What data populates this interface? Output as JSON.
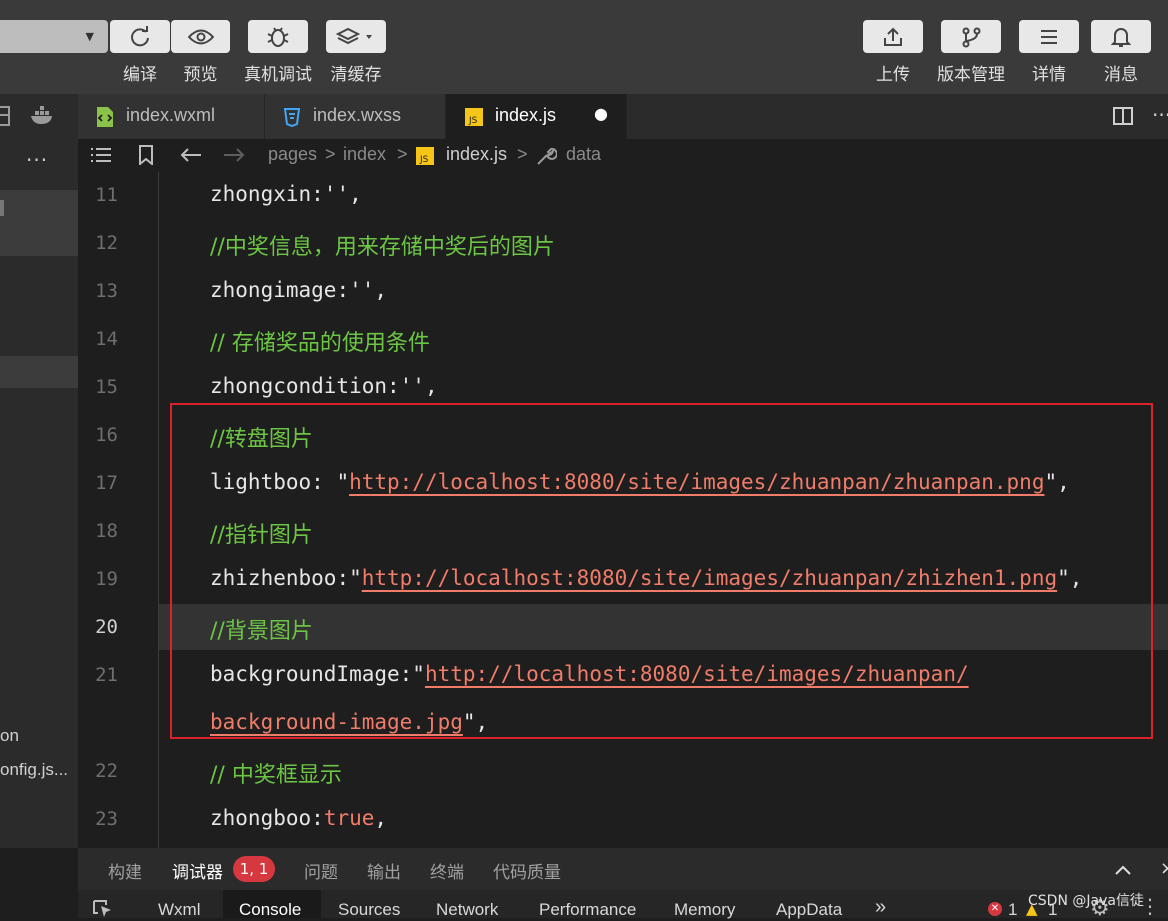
{
  "toolbar": {
    "left_buttons": [
      {
        "label": "编译",
        "icon": "refresh-icon"
      },
      {
        "label": "预览",
        "icon": "eye-icon"
      },
      {
        "label": "真机调试",
        "icon": "bug-icon"
      },
      {
        "label": "清缓存",
        "icon": "layers-icon"
      }
    ],
    "right_buttons": [
      {
        "label": "上传",
        "icon": "upload-icon"
      },
      {
        "label": "版本管理",
        "icon": "branch-icon"
      },
      {
        "label": "详情",
        "icon": "menu-icon"
      },
      {
        "label": "消息",
        "icon": "bell-icon"
      }
    ]
  },
  "sidebar": {
    "more_label": "···",
    "file_items": [
      "on",
      "onfig.js..."
    ]
  },
  "tabs": [
    {
      "label": "index.wxml",
      "icon": "wxml-file-icon",
      "active": false
    },
    {
      "label": "index.wxss",
      "icon": "wxss-file-icon",
      "active": false
    },
    {
      "label": "index.js",
      "icon": "js-file-icon",
      "active": true,
      "modified_dot": "●"
    }
  ],
  "breadcrumb": {
    "items": [
      "pages",
      "index",
      "index.js",
      "data"
    ],
    "separator": ">"
  },
  "editor": {
    "current_line": "20",
    "lines": [
      {
        "n": "11",
        "key": "zhongxin",
        "rest": ":'',"
      },
      {
        "n": "12",
        "comment": "//中奖信息，用来存储中奖后的图片"
      },
      {
        "n": "13",
        "key": "zhongimage",
        "rest": ":'',"
      },
      {
        "n": "14",
        "comment": "// 存储奖品的使用条件"
      },
      {
        "n": "15",
        "key": "zhongcondition",
        "rest": ":'',"
      },
      {
        "n": "16",
        "comment": "//转盘图片"
      },
      {
        "n": "17",
        "key": "lightboo",
        "sep": ": \"",
        "url": "http://localhost:8080/site/images/zhuanpan/zhuanpan.png",
        "end": "\","
      },
      {
        "n": "18",
        "comment": "//指针图片"
      },
      {
        "n": "19",
        "key": "zhizhenboo",
        "sep": ":\"",
        "url": "http://localhost:8080/site/images/zhuanpan/zhizhen1.png",
        "end": "\","
      },
      {
        "n": "20",
        "comment": "//背景图片"
      },
      {
        "n": "21",
        "key": "backgroundImage",
        "sep": ":\"",
        "url": "http://localhost:8080/site/images/zhuanpan/",
        "url2": "background-image.jpg",
        "end": "\","
      },
      {
        "n": "22",
        "comment": "// 中奖框显示"
      },
      {
        "n": "23",
        "key": "zhongboo",
        "sep": ":",
        "value": "true",
        "end": ","
      }
    ]
  },
  "bottom_panel": {
    "tabs": [
      "构建",
      "调试器",
      "问题",
      "输出",
      "终端",
      "代码质量"
    ],
    "active_tab": "调试器",
    "badge": "1, 1",
    "devtools_tabs": [
      "Wxml",
      "Console",
      "Sources",
      "Network",
      "Performance",
      "Memory",
      "AppData"
    ],
    "devtools_active": "Console",
    "more": "»",
    "errors": "1",
    "warnings": "1"
  },
  "watermark": "CSDN @Java信徒",
  "colors": {
    "comment": "#6cc644",
    "string": "#f07c69",
    "highlight_box": "#d8232a",
    "badge": "#d6383f"
  }
}
